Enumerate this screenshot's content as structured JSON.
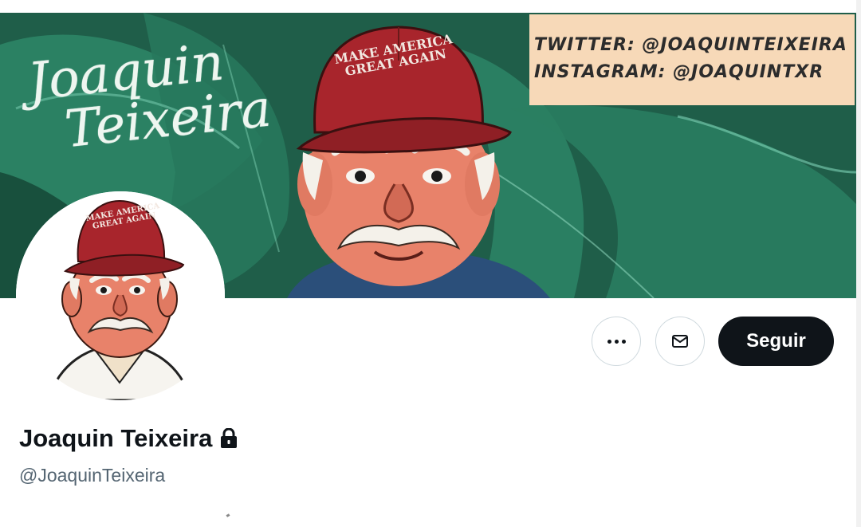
{
  "banner": {
    "signature_line1": "Joaquin",
    "signature_line2": "Teixeira",
    "hat_text": "MAKE AMERICA GREAT AGAIN",
    "social_line1": "TWITTER: @JOAQUINTEIXEIRA",
    "social_line2": "INSTAGRAM: @JOAQUINTXR"
  },
  "avatar": {
    "hat_text": "MAKE AMERICA GREAT AGAIN"
  },
  "actions": {
    "more_icon": "more-horizontal-icon",
    "message_icon": "envelope-icon",
    "follow_label": "Seguir"
  },
  "profile": {
    "display_name": "Joaquin Teixeira",
    "lock_icon": "lock-icon",
    "handle": "@JoaquinTeixeira"
  },
  "colors": {
    "follow_bg": "#0f1419",
    "handle": "#536471",
    "banner_green": "#1f5e49",
    "social_box": "#f7d9b8",
    "hat_red": "#a8252c"
  }
}
